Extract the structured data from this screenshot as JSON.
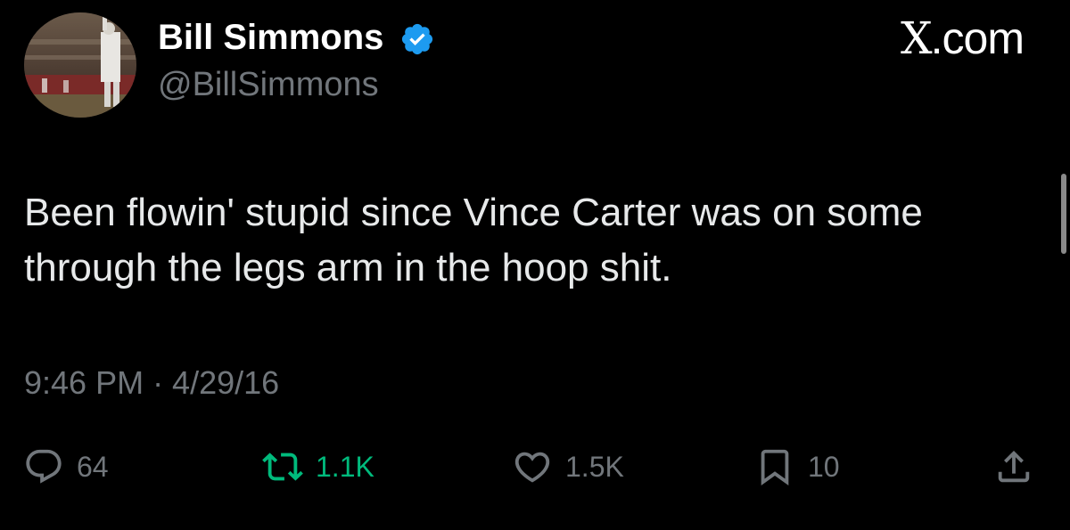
{
  "author": {
    "name": "Bill Simmons",
    "handle": "@BillSimmons",
    "verified": true
  },
  "brand": {
    "label": ".com",
    "mark": "X"
  },
  "tweet": {
    "lines": [
      "Been flowin' stupid since Vince Carter was on some",
      "through the legs arm in the hoop shit."
    ],
    "timestamp": "9:46 PM · 4/29/16"
  },
  "actions": {
    "replies": "64",
    "retweets": "1.1K",
    "likes": "1.5K",
    "bookmarks": "10"
  },
  "colors": {
    "background": "#000000",
    "text": "#e7e9ea",
    "muted": "#71767b",
    "verified": "#1d9bf0",
    "retweet": "#00ba7c"
  },
  "icons": [
    "verified-badge-icon",
    "reply-icon",
    "retweet-icon",
    "like-icon",
    "bookmark-icon",
    "share-icon"
  ]
}
